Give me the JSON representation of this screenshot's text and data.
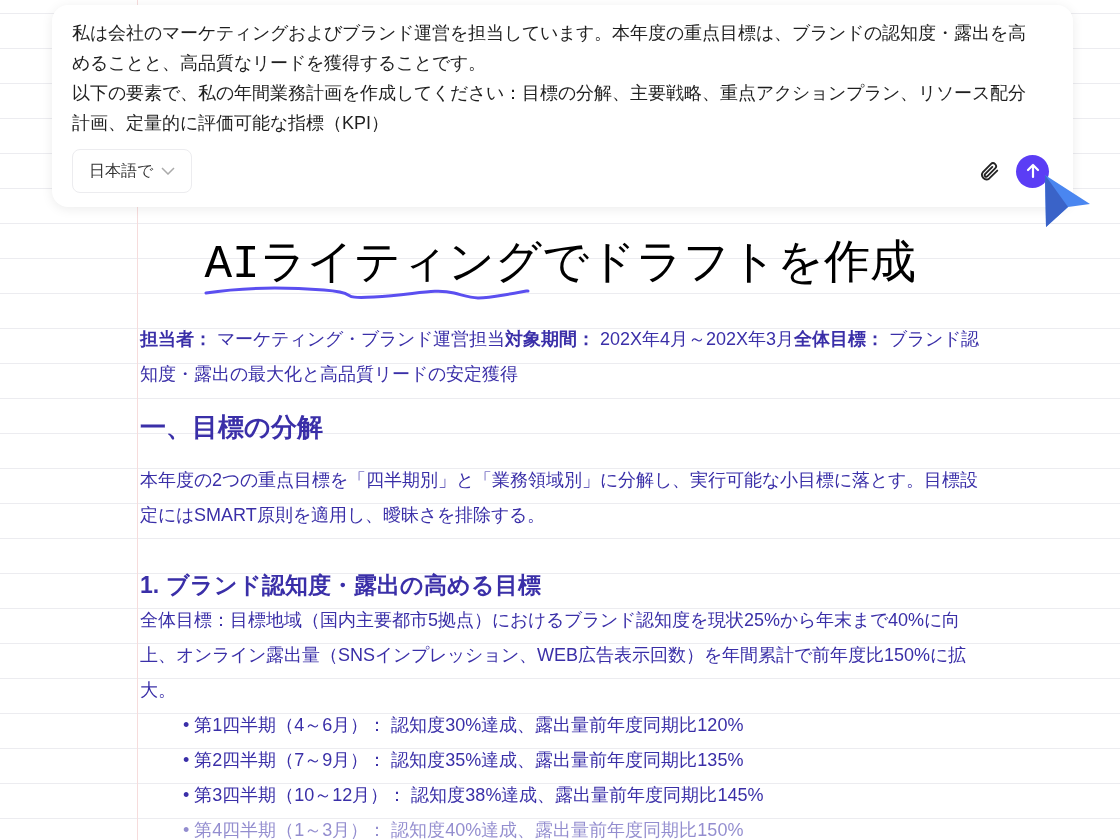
{
  "prompt": {
    "paragraphs": [
      "私は会社のマーケティングおよびブランド運営を担当しています。本年度の重点目標は、ブランドの認知度・露出を高めることと、高品質なリードを獲得することです。",
      "以下の要素で、私の年間業務計画を作成してください：目標の分解、主要戦略、重点アクションプラン、リソース配分計画、定量的に評価可能な指標（KPI）"
    ],
    "language": "日本語で"
  },
  "headline": {
    "highlight": "AIライティング",
    "rest": "でドラフトを作成"
  },
  "document": [
    {
      "kind": "meta",
      "text": "**担当者：** マーケティング・ブランド運営担当**対象期間：** 202X年4月～202X年3月**全体目標：** ブランド認知度・露出の最大化と高品質リードの安定獲得"
    },
    {
      "kind": "heading",
      "text": "一、目標の分解"
    },
    {
      "kind": "paragraph",
      "text": "本年度の2つの重点目標を「四半期別」と「業務領域別」に分解し、実行可能な小目標に落とす。目標設定にはSMART原則を適用し、曖昧さを排除する。"
    },
    {
      "kind": "subheading",
      "text": "1. ブランド認知度・露出の高める目標"
    },
    {
      "kind": "paragraph",
      "text": "全体目標：目標地域（国内主要都市5拠点）におけるブランド認知度を現状25%から年末まで40%に向上、オンライン露出量（SNSインプレッション、WEB広告表示回数）を年間累計で前年度比150%に拡大。"
    },
    {
      "kind": "bullet",
      "bullet": "•",
      "text": "第1四半期（4～6月）： 認知度30%達成、露出量前年度同期比120%",
      "faded": false
    },
    {
      "kind": "bullet",
      "bullet": "•",
      "text": "第2四半期（7～9月）： 認知度35%達成、露出量前年度同期比135%",
      "faded": false
    },
    {
      "kind": "bullet",
      "bullet": "•",
      "text": "第3四半期（10～12月）： 認知度38%達成、露出量前年度同期比145%",
      "faded": false
    },
    {
      "kind": "bullet",
      "bullet": "•",
      "text": "第4四半期（1～3月）： 認知度40%達成、露出量前年度同期比150%",
      "faded": true
    }
  ]
}
